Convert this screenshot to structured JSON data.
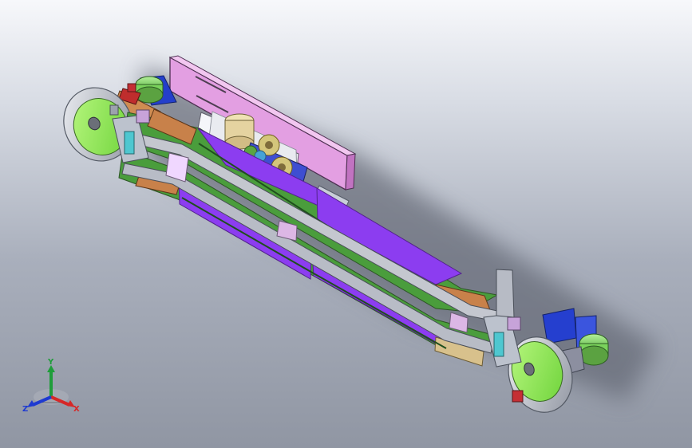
{
  "model": {
    "name": "conveyor-assembly"
  },
  "triad": {
    "x_label": "X",
    "y_label": "Y",
    "z_label": "Z",
    "colors": {
      "x": "#d62828",
      "y": "#1f9d3a",
      "z": "#1e3ad1"
    }
  },
  "colors": {
    "belt_main": "#8c3df0",
    "belt_green": "#4a9d3c",
    "pulley": "#9dee58",
    "pulley_rim": "#d5d8e0",
    "plate_pink": "#e39fe2",
    "motor_green": "#82d862",
    "bracket_blue": "#233fd0",
    "mount_orange": "#c8814a",
    "mount_tan": "#e5c18a",
    "gear_tan": "#d4c67b",
    "frame_silver": "#c4c7cf",
    "background_top": "#f7f8fb",
    "background_bottom": "#9096a3"
  }
}
